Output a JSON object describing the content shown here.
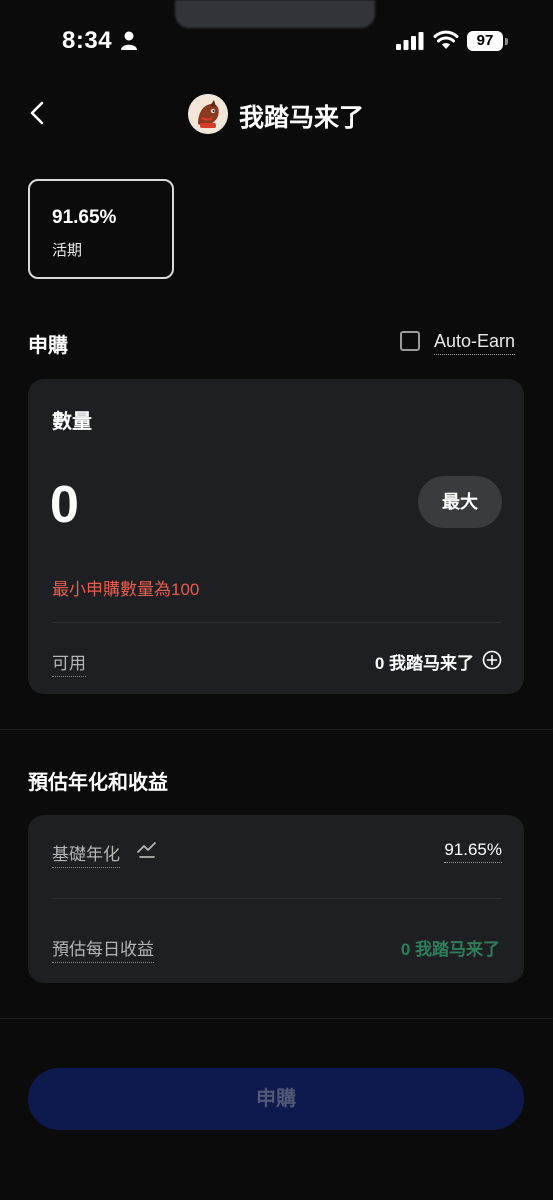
{
  "status_bar": {
    "time": "8:34",
    "battery": "97"
  },
  "header": {
    "title": "我踏马来了"
  },
  "rate_card": {
    "rate": "91.65%",
    "term": "活期"
  },
  "subscribe_section": {
    "title": "申購",
    "auto_earn_label": "Auto-Earn",
    "auto_earn_checked": false
  },
  "amount_card": {
    "quantity_label": "數量",
    "quantity_value": "0",
    "max_button": "最大",
    "min_warning": "最小申購數量為100",
    "available_label": "可用",
    "available_value": "0 我踏马来了"
  },
  "estimate_section": {
    "title": "預估年化和收益",
    "base_apr_label": "基礎年化",
    "base_apr_value": "91.65%",
    "daily_earnings_label": "預估每日收益",
    "daily_earnings_value": "0 我踏马来了"
  },
  "footer": {
    "subscribe_button": "申購"
  },
  "colors": {
    "background": "#0b0b0c",
    "card": "#1e1f22",
    "warning": "#e65c4f",
    "positive": "#2f7d5b",
    "button_disabled_bg": "#0e1a4d",
    "button_disabled_text": "#4f5877"
  }
}
